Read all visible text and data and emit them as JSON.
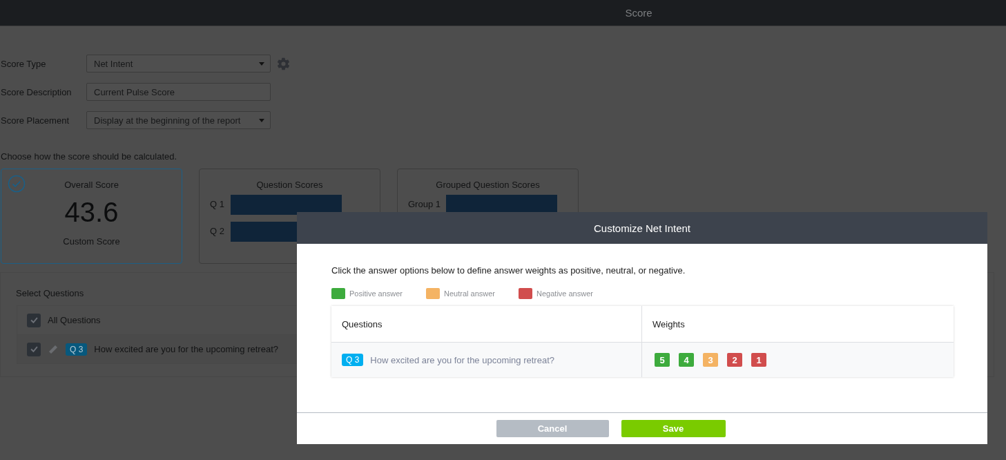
{
  "top_bar": {
    "title": "Score"
  },
  "form": [
    {
      "label": "Score Type",
      "kind": "select",
      "value": "Net Intent",
      "settings": true
    },
    {
      "label": "Score Description",
      "kind": "text",
      "value": "Current Pulse Score",
      "settings": false
    },
    {
      "label": "Score Placement",
      "kind": "select",
      "value": "Display at the beginning of the report",
      "settings": false
    }
  ],
  "calc_prompt": "Choose how the score should be calculated.",
  "score_cards": [
    {
      "title": "Overall Score",
      "kind": "number",
      "selected": true,
      "value": "43.6",
      "caption": "Custom Score"
    },
    {
      "title": "Question Scores",
      "kind": "bars",
      "selected": false,
      "bars": [
        "Q 1",
        "Q 2"
      ]
    },
    {
      "title": "Grouped Question Scores",
      "kind": "bars",
      "selected": false,
      "bars": [
        "Group 1"
      ]
    }
  ],
  "select_questions": {
    "title": "Select Questions",
    "items": [
      {
        "kind": "all",
        "checked": true,
        "label": "All Questions"
      },
      {
        "kind": "question",
        "checked": true,
        "tag": "Q 3",
        "label": "How excited are you for the upcoming retreat?"
      }
    ]
  },
  "dialog": {
    "title": "Customize Net Intent",
    "instructions": "Click the answer options below to define answer weights as positive, neutral, or negative.",
    "legend": [
      {
        "label": "Positive answer",
        "color": "#3dab3d"
      },
      {
        "label": "Neutral answer",
        "color": "#f4b363"
      },
      {
        "label": "Negative answer",
        "color": "#d14d4d"
      }
    ],
    "columns": [
      "Questions",
      "Weights"
    ],
    "rows": [
      {
        "tag": "Q 3",
        "question": "How excited are you for the upcoming retreat?",
        "weights": [
          {
            "label": "5",
            "color": "#3dab3d"
          },
          {
            "label": "4",
            "color": "#3dab3d"
          },
          {
            "label": "3",
            "color": "#f4b363"
          },
          {
            "label": "2",
            "color": "#d14d4d"
          },
          {
            "label": "1",
            "color": "#d14d4d"
          }
        ]
      }
    ],
    "buttons": [
      {
        "label": "Cancel",
        "kind": "secondary"
      },
      {
        "label": "Save",
        "kind": "primary"
      }
    ]
  }
}
